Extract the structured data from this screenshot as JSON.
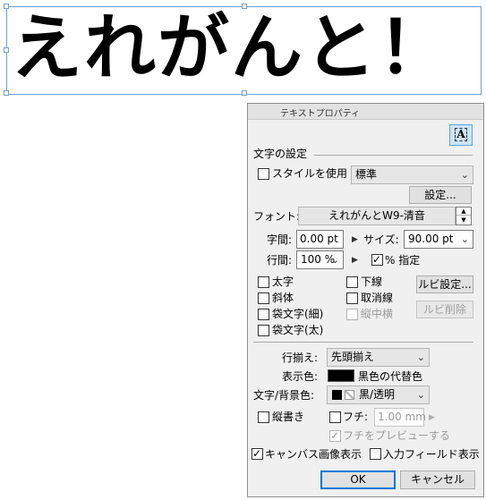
{
  "canvas": {
    "text": "えれがんと！"
  },
  "dialog": {
    "title": "テキストプロパティ",
    "toggle_icon_label": "A",
    "text_settings_heading": "文字の設定",
    "use_style_label": "スタイルを使用",
    "use_style_checked": false,
    "style_value": "標準",
    "style_settings_button": "設定...",
    "font_label": "フォント:",
    "font_value": "えれがんとW9-清音",
    "char_spacing_label": "字間:",
    "char_spacing_value": "0.00 pt",
    "size_label": "サイズ:",
    "size_value": "90.00 pt",
    "line_spacing_label": "行間:",
    "line_spacing_value": "100 %",
    "percent_spec_label": "% 指定",
    "percent_spec_checked": true,
    "bold_label": "太字",
    "italic_label": "斜体",
    "outline_thin_label": "袋文字(細)",
    "outline_thick_label": "袋文字(太)",
    "underline_label": "下線",
    "strikethrough_label": "取消線",
    "tate_chu_yoko_label": "縦中横",
    "ruby_settings_button": "ルビ設定...",
    "ruby_delete_button": "ルビ削除",
    "alignment_label": "行揃え:",
    "alignment_value": "先頭揃え",
    "display_color_label": "表示色:",
    "display_color_value": "黒色の代替色",
    "display_color_swatch": "#000000",
    "text_bg_color_label": "文字/背景色:",
    "text_bg_color_value": "黒/透明",
    "vertical_label": "縦書き",
    "edge_label": "フチ:",
    "edge_value": "1.00 mm",
    "preview_edge_label": "フチをプレビューする",
    "preview_edge_checked": true,
    "canvas_image_label": "キャンバス画像表示",
    "canvas_image_checked": true,
    "input_field_label": "入力フィールド表示",
    "input_field_checked": false,
    "ok_button": "OK",
    "cancel_button": "キャンセル",
    "accent_color": "#0078d7"
  }
}
